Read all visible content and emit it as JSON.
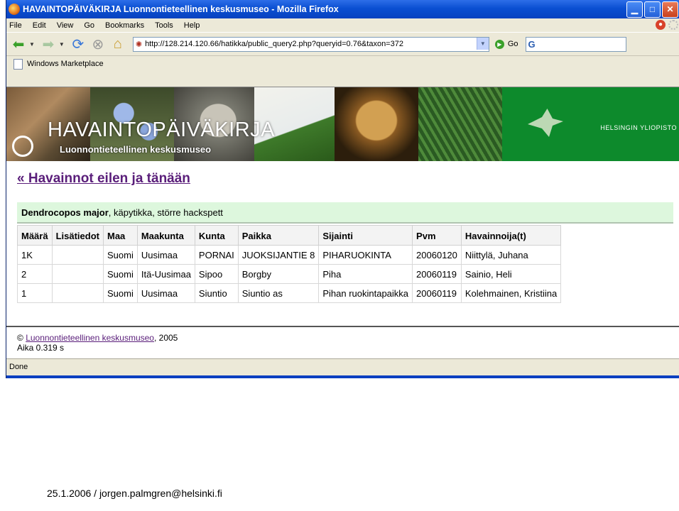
{
  "window": {
    "title": "HAVAINTOPÄIVÄKIRJA Luonnontieteellinen keskusmuseo - Mozilla Firefox"
  },
  "menu": [
    "File",
    "Edit",
    "View",
    "Go",
    "Bookmarks",
    "Tools",
    "Help"
  ],
  "address": {
    "url": "http://128.214.120.66/hatikka/public_query2.php?queryid=0.76&taxon=372",
    "go_label": "Go"
  },
  "bookmarks": [
    {
      "label": "Windows Marketplace"
    }
  ],
  "banner": {
    "title": "HAVAINTOPÄIVÄKIRJA",
    "subtitle": "Luonnontieteellinen keskusmuseo",
    "university": "HELSINGIN YLIOPISTO"
  },
  "page": {
    "back_link": "« Havainnot eilen ja tänään",
    "species_latin": "Dendrocopos major",
    "species_rest": ", käpytikka, större hackspett"
  },
  "table": {
    "headers": [
      "Määrä",
      "Lisätiedot",
      "Maa",
      "Maakunta",
      "Kunta",
      "Paikka",
      "Sijainti",
      "Pvm",
      "Havainnoija(t)"
    ],
    "rows": [
      [
        "1K",
        "",
        "Suomi",
        "Uusimaa",
        "PORNAI",
        "JUOKSIJANTIE 8",
        "PIHARUOKINTA",
        "20060120",
        "Niittylä, Juhana"
      ],
      [
        "2",
        "",
        "Suomi",
        "Itä-Uusimaa",
        "Sipoo",
        "Borgby",
        "Piha",
        "20060119",
        "Sainio, Heli"
      ],
      [
        "1",
        "",
        "Suomi",
        "Uusimaa",
        "Siuntio",
        "Siuntio as",
        "Pihan ruokintapaikka",
        "20060119",
        "Kolehmainen, Kristiina"
      ]
    ]
  },
  "footer": {
    "copyright": "©",
    "link": "Luonnontieteellinen keskusmuseo",
    "year": ", 2005",
    "time": "Aika 0.319 s"
  },
  "status": "Done",
  "slide_footer": "25.1.2006 / jorgen.palmgren@helsinki.fi"
}
